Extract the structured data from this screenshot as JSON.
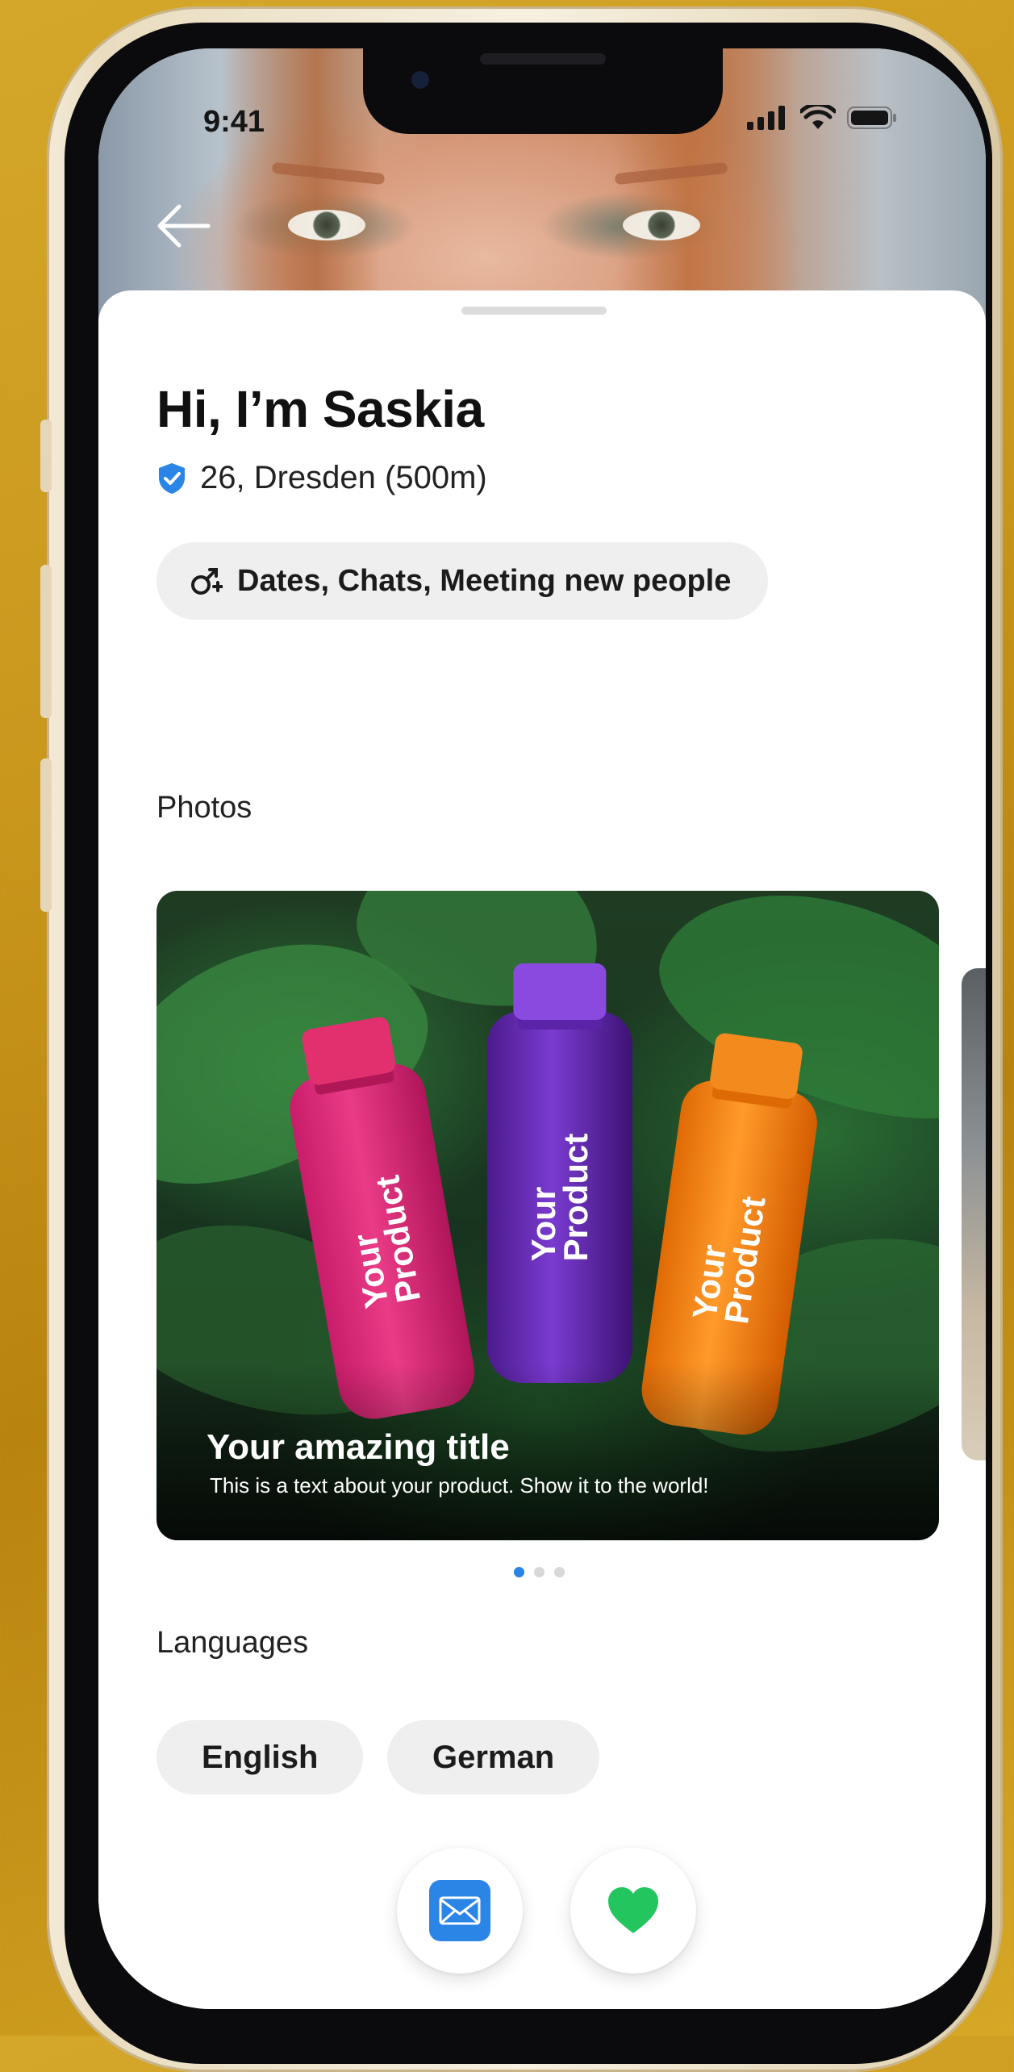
{
  "status_bar": {
    "time": "9:41"
  },
  "profile": {
    "title": "Hi, I’m Saskia",
    "age_location": "26, Dresden (500m)",
    "intent": "Dates, Chats, Meeting new people"
  },
  "photos": {
    "section_label": "Photos",
    "card": {
      "bottle_text": "Your\nProduct",
      "title": "Your amazing title",
      "description": "This is a text about your product. Show it to the world!"
    },
    "page_count": 3,
    "active_index": 0
  },
  "languages": {
    "section_label": "Languages",
    "items": [
      "English",
      "German"
    ]
  },
  "actions": {
    "message_icon": "envelope-icon",
    "like_icon": "heart-icon"
  },
  "colors": {
    "accent_blue": "#2A85E6",
    "like_green": "#22C55E",
    "background_gold": "#C9961C"
  }
}
